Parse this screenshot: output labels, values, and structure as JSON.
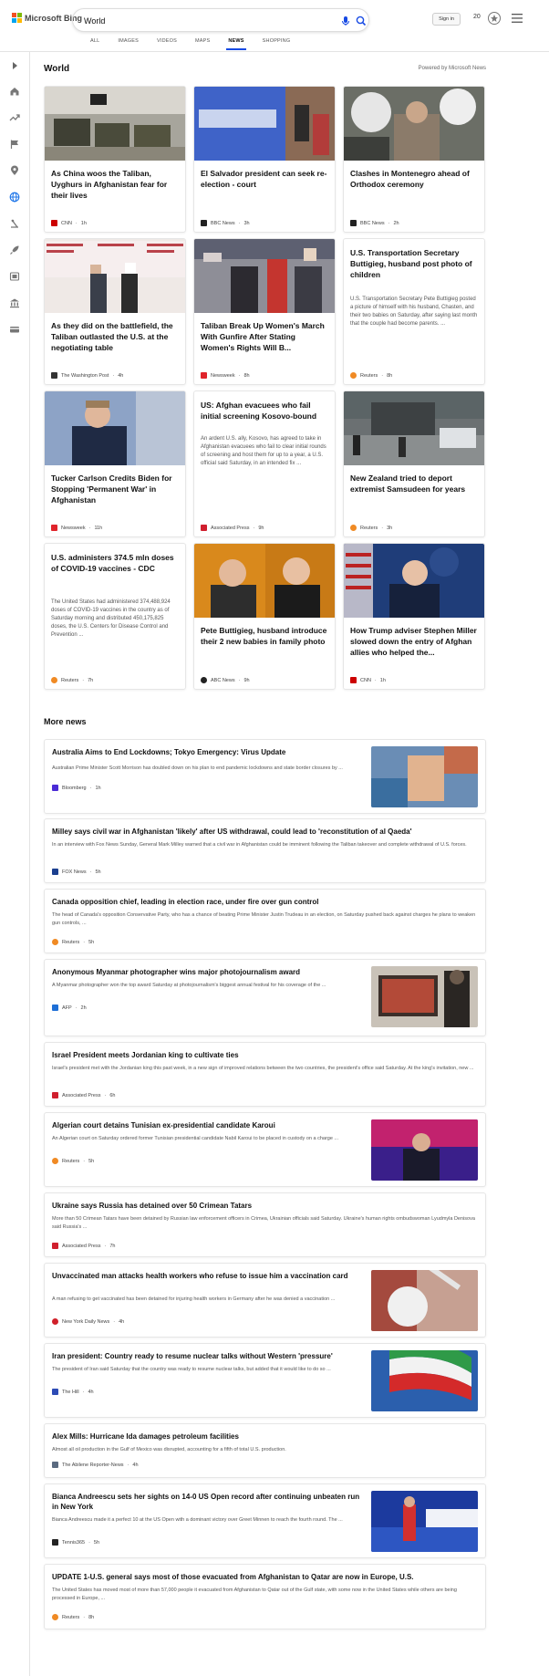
{
  "header": {
    "logo_text": "Microsoft Bing",
    "search_value": "World",
    "signin_label": "Sign in",
    "points": "20",
    "tabs": [
      "ALL",
      "IMAGES",
      "VIDEOS",
      "MAPS",
      "NEWS",
      "SHOPPING"
    ],
    "active_tab": "NEWS"
  },
  "section": {
    "title": "World",
    "powered_by": "Powered by Microsoft News"
  },
  "cards": [
    {
      "title": "As China woos the Taliban, Uyghurs in Afghanistan fear for their lives",
      "summary": "",
      "source": "CNN",
      "time": "1h",
      "source_color": "#cc0000"
    },
    {
      "title": "El Salvador president can seek re-election - court",
      "summary": "",
      "source": "BBC News",
      "time": "3h",
      "source_color": "#222222"
    },
    {
      "title": "Clashes in Montenegro ahead of Orthodox ceremony",
      "summary": "",
      "source": "BBC News",
      "time": "2h",
      "source_color": "#222222"
    },
    {
      "title": "As they did on the battlefield, the Taliban outlasted the U.S. at the negotiating table",
      "summary": "",
      "source": "The Washington Post",
      "time": "4h",
      "source_color": "#333333"
    },
    {
      "title": "Taliban Break Up Women's March With Gunfire After Stating Women's Rights Will B...",
      "summary": "",
      "source": "Newsweek",
      "time": "8h",
      "source_color": "#e0242b"
    },
    {
      "title": "U.S. Transportation Secretary Buttigieg, husband post photo of children",
      "summary": "U.S. Transportation Secretary Pete Buttigieg posted a picture of himself with his husband, Chasten, and their two babies on Saturday, after saying last month that the couple had become parents. ...",
      "source": "Reuters",
      "time": "8h",
      "source_color": "#f08a24"
    },
    {
      "title": "Tucker Carlson Credits Biden for Stopping 'Permanent War' in Afghanistan",
      "summary": "",
      "source": "Newsweek",
      "time": "11h",
      "source_color": "#e0242b"
    },
    {
      "title": "US: Afghan evacuees who fail initial screening Kosovo-bound",
      "summary": "An ardent U.S. ally, Kosovo, has agreed to take in Afghanistan evacuees who fail to clear initial rounds of screening and host them for up to a year, a U.S. official said Saturday, in an intended fix ...",
      "source": "Associated Press",
      "time": "9h",
      "source_color": "#d01f2e"
    },
    {
      "title": "New Zealand tried to deport extremist Samsudeen for years",
      "summary": "",
      "source": "Reuters",
      "time": "3h",
      "source_color": "#f08a24"
    },
    {
      "title": "U.S. administers 374.5 mln doses of COVID-19 vaccines - CDC",
      "summary": "The United States had administered 374,488,924 doses of COVID-19 vaccines in the country as of Saturday morning and distributed 450,175,825 doses, the U.S. Centers for Disease Control and Prevention ...",
      "source": "Reuters",
      "time": "7h",
      "source_color": "#f08a24"
    },
    {
      "title": "Pete Buttigieg, husband introduce their 2 new babies in family photo",
      "summary": "",
      "source": "ABC News",
      "time": "9h",
      "source_color": "#222222"
    },
    {
      "title": "How Trump adviser Stephen Miller slowed down the entry of Afghan allies who helped the...",
      "summary": "",
      "source": "CNN",
      "time": "1h",
      "source_color": "#cc0000"
    }
  ],
  "more": {
    "title": "More news",
    "items": [
      {
        "title": "Australia Aims to End Lockdowns; Tokyo Emergency: Virus Update",
        "summary": "Australian Prime Minister Scott Morrison has doubled down on his plan to end pandemic lockdowns and state border closures by ...",
        "source": "Bloomberg",
        "time": "1h",
        "source_color": "#4a2bd6"
      },
      {
        "title": "Milley says civil war in Afghanistan 'likely' after US withdrawal, could lead to 'reconstitution of al Qaeda'",
        "summary": "In an interview with Fox News Sunday, General Mark Milley warned that a civil war in Afghanistan could be imminent following the Taliban takeover and complete withdrawal of U.S. forces.",
        "source": "FOX News",
        "time": "5h",
        "source_color": "#1b3f8f"
      },
      {
        "title": "Canada opposition chief, leading in election race, under fire over gun control",
        "summary": "The head of Canada's opposition Conservative Party, who has a chance of beating Prime Minister Justin Trudeau in an election, on Saturday pushed back against charges he plans to weaken gun controls, ...",
        "source": "Reuters",
        "time": "5h",
        "source_color": "#f08a24"
      },
      {
        "title": "Anonymous Myanmar photographer wins major photojournalism award",
        "summary": "A Myanmar photographer won the top award Saturday at photojournalism's biggest annual festival for his coverage of the ...",
        "source": "AFP",
        "time": "2h",
        "source_color": "#1e6fd6"
      },
      {
        "title": "Israel President meets Jordanian king to cultivate ties",
        "summary": "Israel's president met with the Jordanian king this past week, in a new sign of improved relations between the two countries, the president's office said Saturday. At the king's invitation, new ...",
        "source": "Associated Press",
        "time": "6h",
        "source_color": "#d01f2e"
      },
      {
        "title": "Algerian court detains Tunisian ex-presidential candidate Karoui",
        "summary": "An Algerian court on Saturday ordered former Tunisian presidential candidate Nabil Karoui to be placed in custody on a charge ...",
        "source": "Reuters",
        "time": "5h",
        "source_color": "#f08a24"
      },
      {
        "title": "Ukraine says Russia has detained over 50 Crimean Tatars",
        "summary": "More than 50 Crimean Tatars have been detained by Russian law enforcement officers in Crimea, Ukrainian officials said Saturday. Ukraine's human rights ombudswoman Lyudmyla Denisova said Russia's ...",
        "source": "Associated Press",
        "time": "7h",
        "source_color": "#d01f2e"
      },
      {
        "title": "Unvaccinated man attacks health workers who refuse to issue him a vaccination card",
        "summary": "A man refusing to get vaccinated has been detained for injuring health workers in Germany after he was denied a vaccination ...",
        "source": "New York Daily News",
        "time": "4h",
        "source_color": "#d0202a"
      },
      {
        "title": "Iran president: Country ready to resume nuclear talks without Western 'pressure'",
        "summary": "The president of Iran said Saturday that the country was ready to resume nuclear talks, but added that it would like to do so ...",
        "source": "The Hill",
        "time": "4h",
        "source_color": "#2d4bb5"
      },
      {
        "title": "Alex Mills: Hurricane Ida damages petroleum facilities",
        "summary": "Almost all oil production in the Gulf of Mexico was disrupted, accounting for a fifth of total U.S. production.",
        "source": "The Abilene Reporter-News",
        "time": "4h",
        "source_color": "#5a6a80"
      },
      {
        "title": "Bianca Andreescu sets her sights on 14-0 US Open record after continuing unbeaten run in New York",
        "summary": "Bianca Andreescu made it a perfect 10 at the US Open with a dominant victory over Greet Minnen to reach the fourth round. The ...",
        "source": "Tennis365",
        "time": "5h",
        "source_color": "#222222"
      },
      {
        "title": "UPDATE 1-U.S. general says most of those evacuated from Afghanistan to Qatar are now in Europe, U.S.",
        "summary": "The United States has moved most of more than 57,000 people it evacuated from Afghanistan to Qatar out of the Gulf state, with some now in the United States while others are being processed in Europe, ...",
        "source": "Reuters",
        "time": "8h",
        "source_color": "#f08a24"
      }
    ]
  },
  "icons": {
    "rail": [
      "collapse-icon",
      "home-icon",
      "trending-icon",
      "flag-icon",
      "location-icon",
      "globe-icon",
      "science-icon",
      "rocket-icon",
      "entertainment-icon",
      "bank-icon",
      "card-icon"
    ]
  },
  "colors": {
    "accent": "#174ae4",
    "active_rail": "#1a73e8"
  }
}
